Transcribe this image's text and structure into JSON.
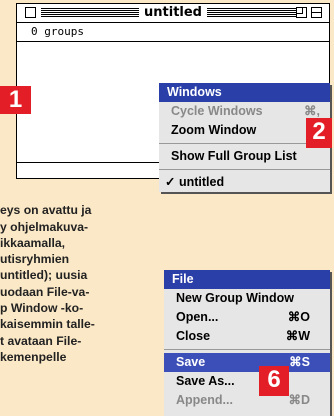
{
  "window": {
    "title": "untitled",
    "groups_count": "0 groups"
  },
  "badges": {
    "one": "1",
    "two": "2",
    "six": "6"
  },
  "windows_menu": {
    "header": "Windows",
    "items": [
      {
        "label": "Cycle Windows",
        "shortcut": "⌘,",
        "disabled": true
      },
      {
        "label": "Zoom Window",
        "shortcut": "",
        "disabled": false
      },
      {
        "label": "Show Full Group List",
        "shortcut": "",
        "disabled": false
      },
      {
        "label": "✓ untitled",
        "shortcut": "",
        "disabled": false
      }
    ]
  },
  "file_menu": {
    "header": "File",
    "items": [
      {
        "label": "New Group Window",
        "shortcut": ""
      },
      {
        "label": "Open...",
        "shortcut": "⌘O"
      },
      {
        "label": "Close",
        "shortcut": "⌘W"
      },
      {
        "label": "Save",
        "shortcut": "⌘S"
      },
      {
        "label": "Save As...",
        "shortcut": ""
      },
      {
        "label": "Append...",
        "shortcut": "⌘D"
      }
    ]
  },
  "body_lines": [
    "eys on avattu ja",
    "y ohjelmakuva-",
    "ikkaamalla,",
    "utisryhmien",
    "untitled); uusia",
    "uodaan File-va-",
    "p Window -ko-",
    "kaisemmin talle-",
    "t avataan File-",
    "kemenpelle"
  ],
  "colors": {
    "page_bg": "#fbe8c6",
    "badge_red": "#e41e26",
    "menu_head_blue": "#2a3fa8",
    "menu_bg": "#e6e6e6"
  }
}
